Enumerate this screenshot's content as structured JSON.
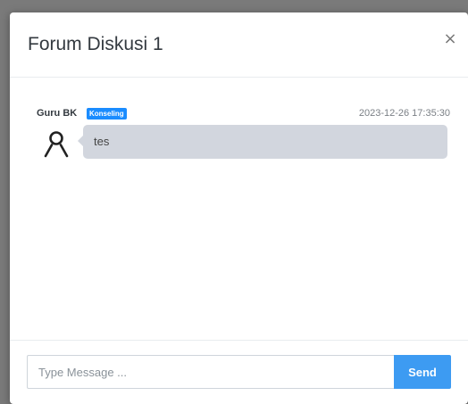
{
  "modal": {
    "title": "Forum Diskusi 1",
    "close_glyph": "×"
  },
  "messages": [
    {
      "sender": "Guru BK",
      "badge": "Konseling",
      "timestamp": "2023-12-26 17:35:30",
      "text": "tes",
      "avatar_icon": "user-icon"
    }
  ],
  "composer": {
    "placeholder": "Type Message ...",
    "value": "",
    "send_label": "Send"
  },
  "colors": {
    "badge": "#1a8cff",
    "send_button": "#3d9bf2",
    "bubble": "#d2d6de"
  }
}
